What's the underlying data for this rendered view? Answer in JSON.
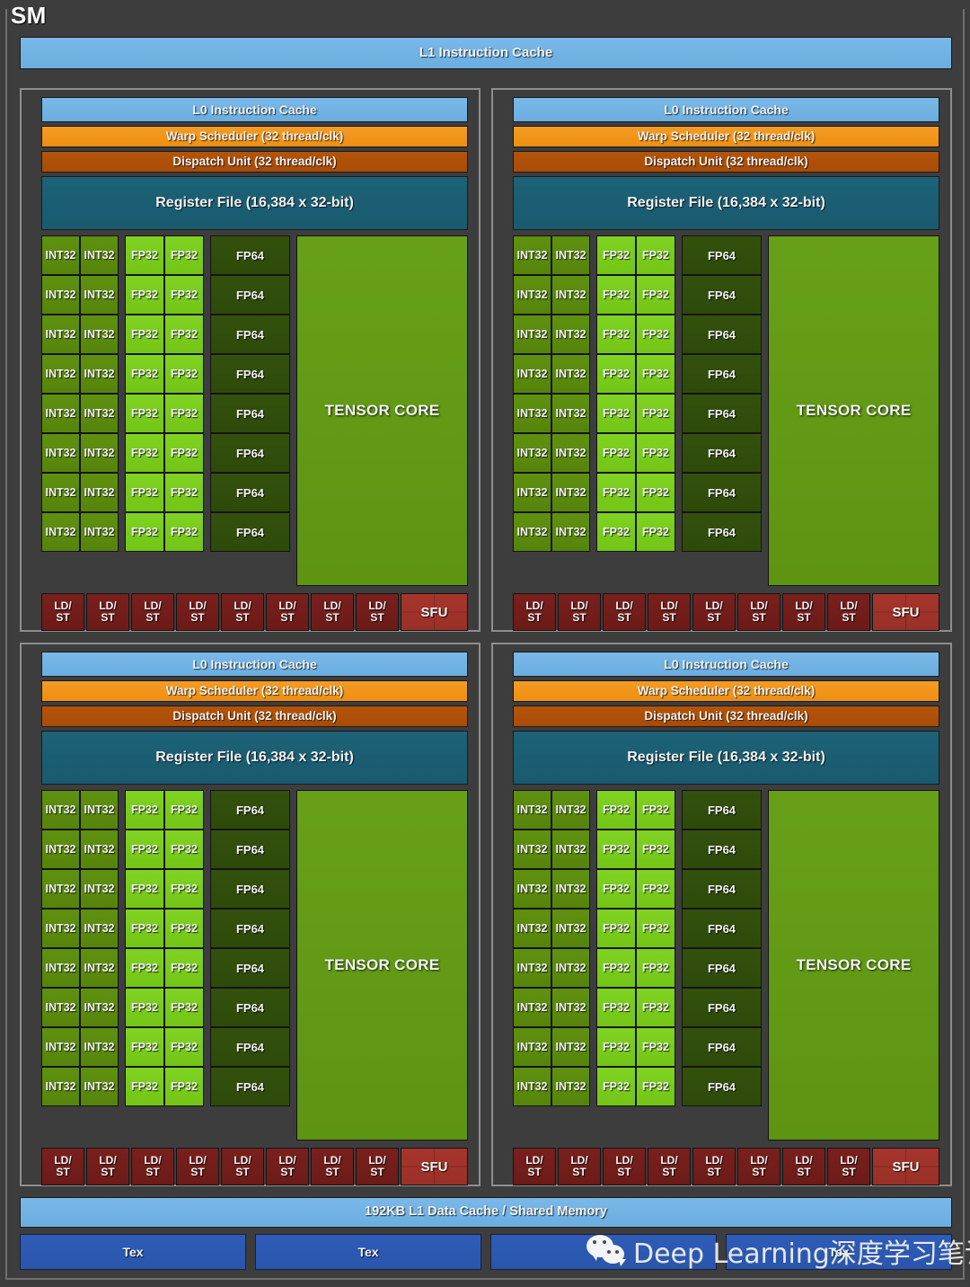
{
  "diagram": {
    "title": "SM",
    "l1_instruction_cache": "L1 Instruction Cache",
    "l1_data_cache": "192KB L1 Data Cache / Shared Memory"
  },
  "processing_block": {
    "l0_instruction_cache": "L0 Instruction Cache",
    "warp_scheduler": "Warp Scheduler (32 thread/clk)",
    "dispatch_unit": "Dispatch Unit (32 thread/clk)",
    "register_file": "Register File (16,384 x 32-bit)",
    "int32_label": "INT32",
    "fp32_label": "FP32",
    "fp64_label": "FP64",
    "tensor_core_label": "TENSOR CORE",
    "ldst_label_line1": "LD/",
    "ldst_label_line2": "ST",
    "sfu_label": "SFU",
    "core_rows": 8,
    "int32_per_row": 2,
    "fp32_per_row": 2,
    "fp64_per_row": 1,
    "ldst_count": 8,
    "sfu_count": 1
  },
  "tex_units": [
    {
      "label": "Tex"
    },
    {
      "label": "Tex"
    },
    {
      "label": "Tex"
    },
    {
      "label": "Tex"
    }
  ],
  "watermark": {
    "icon": "wechat-icon",
    "text": "Deep Learning深度学习笔记"
  },
  "colors": {
    "background": "#3d3d3d",
    "cache_blue": "#6aaedf",
    "warp_orange": "#ee8f10",
    "dispatch_brown": "#a94c07",
    "register_teal": "#195a6e",
    "int32_green": "#56840b",
    "fp32_green": "#73c516",
    "fp64_green": "#2e4a0a",
    "tensor_green": "#5d9412",
    "ldst_red": "#6c1b18",
    "sfu_red": "#993027",
    "tex_blue": "#2a55aa"
  }
}
